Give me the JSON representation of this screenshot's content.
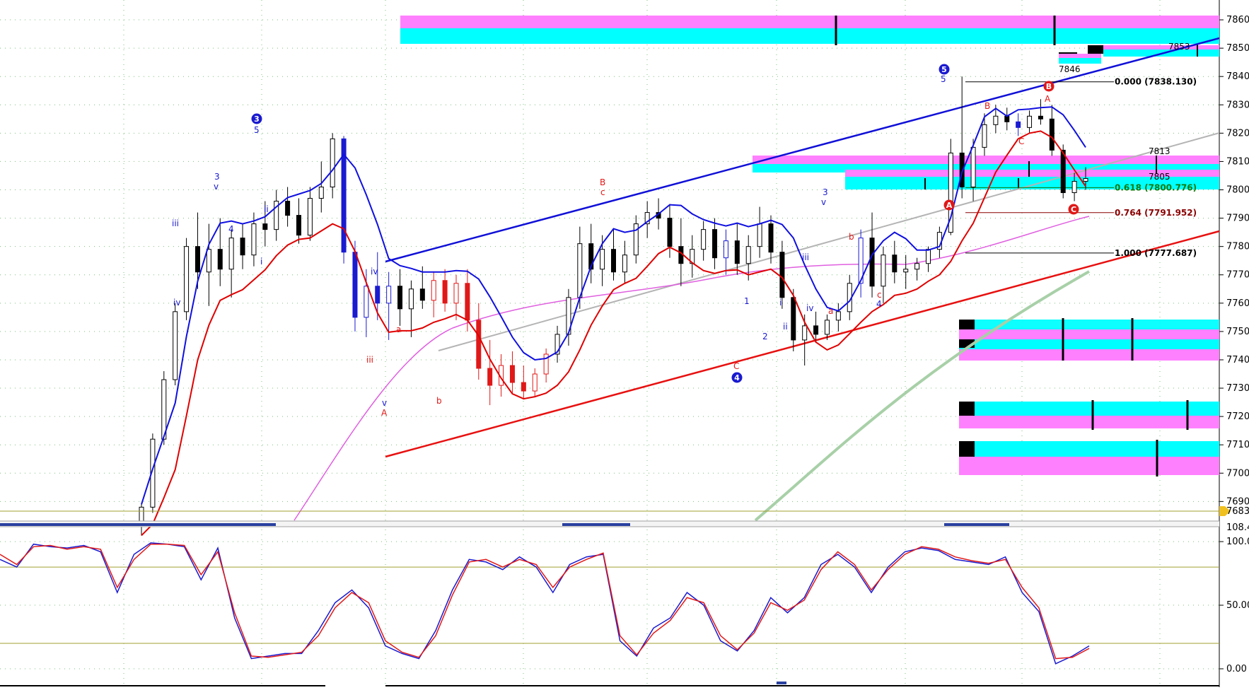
{
  "chart_data": [
    {
      "type": "candlestick",
      "ylim": [
        7683.1,
        7867
      ],
      "y_ticks": [
        "7690.0",
        "7700.0",
        "7710.0",
        "7720.0",
        "7730.0",
        "7740.0",
        "7750.0",
        "7760.0",
        "7770.0",
        "7780.0",
        "7790.0",
        "7800.0",
        "7810.0",
        "7820.0",
        "7830.0",
        "7840.0",
        "7850.0",
        "7860.0"
      ],
      "current_price_label": "7683.1",
      "grid": "dotted",
      "colors": {
        "blue_band": "#1010e0",
        "red_band": "#e00000",
        "magenta_ma": "#e060e0",
        "gray_line": "#b0b0b0",
        "green_ma": "#a8d0a8",
        "cyan_zone": "#00ffff",
        "magenta_zone": "#ff80ff"
      },
      "fibonacci": [
        {
          "ratio_label": "0.000 (7838.130)",
          "value": 7838.13,
          "color": "#000000"
        },
        {
          "ratio_label": "0.618 (7800.776)",
          "value": 7800.776,
          "color": "#0a7a0a"
        },
        {
          "ratio_label": "0.764 (7791.952)",
          "value": 7791.952,
          "color": "#8a0000"
        },
        {
          "ratio_label": "1.000 (7777.687)",
          "value": 7777.687,
          "color": "#000000"
        }
      ],
      "level_labels": [
        {
          "text": "7853",
          "value": 7853
        },
        {
          "text": "7846",
          "value": 7846
        },
        {
          "text": "7813",
          "value": 7813
        },
        {
          "text": "7805",
          "value": 7805
        }
      ],
      "wave_labels_blue": [
        "iii",
        "iv",
        "3",
        "v",
        "3",
        "5",
        "4",
        "ii",
        "i",
        "iv",
        "v",
        "1",
        "2",
        "i",
        "ii",
        "iv",
        "iii",
        "3",
        "v",
        "4",
        "c",
        "5",
        "5",
        "4"
      ],
      "wave_labels_red": [
        "B",
        "c",
        "a",
        "iii",
        "b",
        "A",
        "v",
        "b",
        "a",
        "A",
        "B",
        "C",
        "A",
        "B",
        "C",
        "C"
      ],
      "bars": [
        {
          "o": 7683,
          "h": 7689,
          "l": 7678,
          "c": 7688
        },
        {
          "o": 7688,
          "h": 7714,
          "l": 7686,
          "c": 7712
        },
        {
          "o": 7712,
          "h": 7736,
          "l": 7710,
          "c": 7733
        },
        {
          "o": 7733,
          "h": 7760,
          "l": 7731,
          "c": 7757
        },
        {
          "o": 7757,
          "h": 7783,
          "l": 7754,
          "c": 7780
        },
        {
          "o": 7780,
          "h": 7792,
          "l": 7765,
          "c": 7771
        },
        {
          "o": 7771,
          "h": 7788,
          "l": 7759,
          "c": 7779
        },
        {
          "o": 7779,
          "h": 7790,
          "l": 7766,
          "c": 7772
        },
        {
          "o": 7772,
          "h": 7786,
          "l": 7762,
          "c": 7783
        },
        {
          "o": 7783,
          "h": 7788,
          "l": 7772,
          "c": 7777
        },
        {
          "o": 7777,
          "h": 7792,
          "l": 7773,
          "c": 7788
        },
        {
          "o": 7788,
          "h": 7796,
          "l": 7780,
          "c": 7786
        },
        {
          "o": 7786,
          "h": 7800,
          "l": 7782,
          "c": 7796
        },
        {
          "o": 7796,
          "h": 7801,
          "l": 7787,
          "c": 7791
        },
        {
          "o": 7791,
          "h": 7797,
          "l": 7781,
          "c": 7784
        },
        {
          "o": 7784,
          "h": 7801,
          "l": 7782,
          "c": 7797
        },
        {
          "o": 7797,
          "h": 7810,
          "l": 7792,
          "c": 7801
        },
        {
          "o": 7801,
          "h": 7820,
          "l": 7797,
          "c": 7818
        },
        {
          "o": 7818,
          "h": 7819,
          "l": 7774,
          "c": 7778
        },
        {
          "o": 7778,
          "h": 7782,
          "l": 7750,
          "c": 7755
        },
        {
          "o": 7755,
          "h": 7772,
          "l": 7748,
          "c": 7766
        },
        {
          "o": 7766,
          "h": 7778,
          "l": 7754,
          "c": 7760
        },
        {
          "o": 7760,
          "h": 7771,
          "l": 7747,
          "c": 7766
        },
        {
          "o": 7766,
          "h": 7772,
          "l": 7752,
          "c": 7758
        },
        {
          "o": 7758,
          "h": 7768,
          "l": 7748,
          "c": 7765
        },
        {
          "o": 7765,
          "h": 7773,
          "l": 7758,
          "c": 7761
        },
        {
          "o": 7761,
          "h": 7771,
          "l": 7755,
          "c": 7768
        },
        {
          "o": 7768,
          "h": 7772,
          "l": 7757,
          "c": 7760
        },
        {
          "o": 7760,
          "h": 7770,
          "l": 7754,
          "c": 7767
        },
        {
          "o": 7767,
          "h": 7772,
          "l": 7750,
          "c": 7754
        },
        {
          "o": 7754,
          "h": 7760,
          "l": 7733,
          "c": 7737
        },
        {
          "o": 7737,
          "h": 7747,
          "l": 7724,
          "c": 7731
        },
        {
          "o": 7731,
          "h": 7742,
          "l": 7727,
          "c": 7738
        },
        {
          "o": 7738,
          "h": 7743,
          "l": 7728,
          "c": 7732
        },
        {
          "o": 7732,
          "h": 7738,
          "l": 7726,
          "c": 7729
        },
        {
          "o": 7729,
          "h": 7737,
          "l": 7727,
          "c": 7735
        },
        {
          "o": 7735,
          "h": 7744,
          "l": 7732,
          "c": 7742
        },
        {
          "o": 7742,
          "h": 7752,
          "l": 7739,
          "c": 7749
        },
        {
          "o": 7749,
          "h": 7765,
          "l": 7745,
          "c": 7762
        },
        {
          "o": 7762,
          "h": 7787,
          "l": 7758,
          "c": 7781
        },
        {
          "o": 7781,
          "h": 7788,
          "l": 7767,
          "c": 7772
        },
        {
          "o": 7772,
          "h": 7784,
          "l": 7766,
          "c": 7779
        },
        {
          "o": 7779,
          "h": 7786,
          "l": 7768,
          "c": 7771
        },
        {
          "o": 7771,
          "h": 7782,
          "l": 7767,
          "c": 7777
        },
        {
          "o": 7777,
          "h": 7791,
          "l": 7774,
          "c": 7788
        },
        {
          "o": 7788,
          "h": 7796,
          "l": 7783,
          "c": 7792
        },
        {
          "o": 7792,
          "h": 7797,
          "l": 7786,
          "c": 7790
        },
        {
          "o": 7790,
          "h": 7795,
          "l": 7776,
          "c": 7780
        },
        {
          "o": 7780,
          "h": 7790,
          "l": 7766,
          "c": 7774
        },
        {
          "o": 7774,
          "h": 7784,
          "l": 7769,
          "c": 7779
        },
        {
          "o": 7779,
          "h": 7789,
          "l": 7775,
          "c": 7786
        },
        {
          "o": 7786,
          "h": 7790,
          "l": 7772,
          "c": 7776
        },
        {
          "o": 7776,
          "h": 7786,
          "l": 7770,
          "c": 7782
        },
        {
          "o": 7782,
          "h": 7788,
          "l": 7770,
          "c": 7774
        },
        {
          "o": 7774,
          "h": 7784,
          "l": 7768,
          "c": 7780
        },
        {
          "o": 7780,
          "h": 7794,
          "l": 7776,
          "c": 7788
        },
        {
          "o": 7788,
          "h": 7791,
          "l": 7774,
          "c": 7778
        },
        {
          "o": 7778,
          "h": 7782,
          "l": 7758,
          "c": 7762
        },
        {
          "o": 7762,
          "h": 7765,
          "l": 7743,
          "c": 7747
        },
        {
          "o": 7747,
          "h": 7756,
          "l": 7738,
          "c": 7752
        },
        {
          "o": 7752,
          "h": 7757,
          "l": 7746,
          "c": 7749
        },
        {
          "o": 7749,
          "h": 7756,
          "l": 7747,
          "c": 7754
        },
        {
          "o": 7754,
          "h": 7760,
          "l": 7750,
          "c": 7757
        },
        {
          "o": 7757,
          "h": 7770,
          "l": 7754,
          "c": 7767
        },
        {
          "o": 7767,
          "h": 7786,
          "l": 7762,
          "c": 7783
        },
        {
          "o": 7783,
          "h": 7792,
          "l": 7762,
          "c": 7766
        },
        {
          "o": 7766,
          "h": 7780,
          "l": 7760,
          "c": 7777
        },
        {
          "o": 7777,
          "h": 7782,
          "l": 7767,
          "c": 7771
        },
        {
          "o": 7771,
          "h": 7777,
          "l": 7765,
          "c": 7772
        },
        {
          "o": 7772,
          "h": 7776,
          "l": 7768,
          "c": 7774
        },
        {
          "o": 7774,
          "h": 7780,
          "l": 7771,
          "c": 7779
        },
        {
          "o": 7779,
          "h": 7787,
          "l": 7776,
          "c": 7785
        },
        {
          "o": 7785,
          "h": 7818,
          "l": 7784,
          "c": 7813
        },
        {
          "o": 7813,
          "h": 7840,
          "l": 7797,
          "c": 7801
        },
        {
          "o": 7801,
          "h": 7818,
          "l": 7796,
          "c": 7815
        },
        {
          "o": 7815,
          "h": 7827,
          "l": 7812,
          "c": 7823
        },
        {
          "o": 7823,
          "h": 7830,
          "l": 7820,
          "c": 7826
        },
        {
          "o": 7826,
          "h": 7829,
          "l": 7821,
          "c": 7824
        },
        {
          "o": 7824,
          "h": 7827,
          "l": 7819,
          "c": 7822
        },
        {
          "o": 7822,
          "h": 7828,
          "l": 7820,
          "c": 7826
        },
        {
          "o": 7826,
          "h": 7832,
          "l": 7823,
          "c": 7825
        },
        {
          "o": 7825,
          "h": 7830,
          "l": 7812,
          "c": 7814
        },
        {
          "o": 7814,
          "h": 7816,
          "l": 7797,
          "c": 7799
        },
        {
          "o": 7799,
          "h": 7806,
          "l": 7796,
          "c": 7803
        },
        {
          "o": 7803,
          "h": 7808,
          "l": 7800,
          "c": 7804
        }
      ]
    },
    {
      "type": "line",
      "ylim": [
        0,
        108.4
      ],
      "y_ticks": [
        "0.00",
        "50.00",
        "100.00"
      ],
      "top_label": "108.4",
      "reference_levels": [
        20,
        80
      ],
      "series": [
        {
          "color": "#1a1ad0",
          "values": [
            86,
            80,
            98,
            96,
            95,
            97,
            92,
            60,
            90,
            99,
            98,
            96,
            70,
            95,
            40,
            8,
            10,
            12,
            12,
            30,
            52,
            62,
            48,
            18,
            12,
            8,
            30,
            62,
            86,
            84,
            78,
            88,
            80,
            60,
            82,
            88,
            90,
            22,
            10,
            32,
            40,
            60,
            50,
            22,
            14,
            30,
            56,
            44,
            56,
            82,
            90,
            80,
            60,
            80,
            92,
            95,
            93,
            86,
            84,
            82,
            88,
            60,
            45,
            4,
            10,
            18
          ]
        },
        {
          "color": "#e01818",
          "values": [
            90,
            82,
            96,
            97,
            94,
            96,
            94,
            64,
            86,
            98,
            98,
            97,
            74,
            92,
            44,
            10,
            9,
            11,
            13,
            26,
            48,
            60,
            52,
            22,
            13,
            9,
            26,
            58,
            84,
            86,
            80,
            86,
            82,
            64,
            80,
            86,
            91,
            26,
            11,
            28,
            38,
            56,
            52,
            26,
            15,
            28,
            52,
            46,
            54,
            78,
            92,
            82,
            62,
            78,
            90,
            96,
            94,
            88,
            85,
            83,
            86,
            64,
            48,
            8,
            9,
            16
          ]
        }
      ]
    }
  ]
}
